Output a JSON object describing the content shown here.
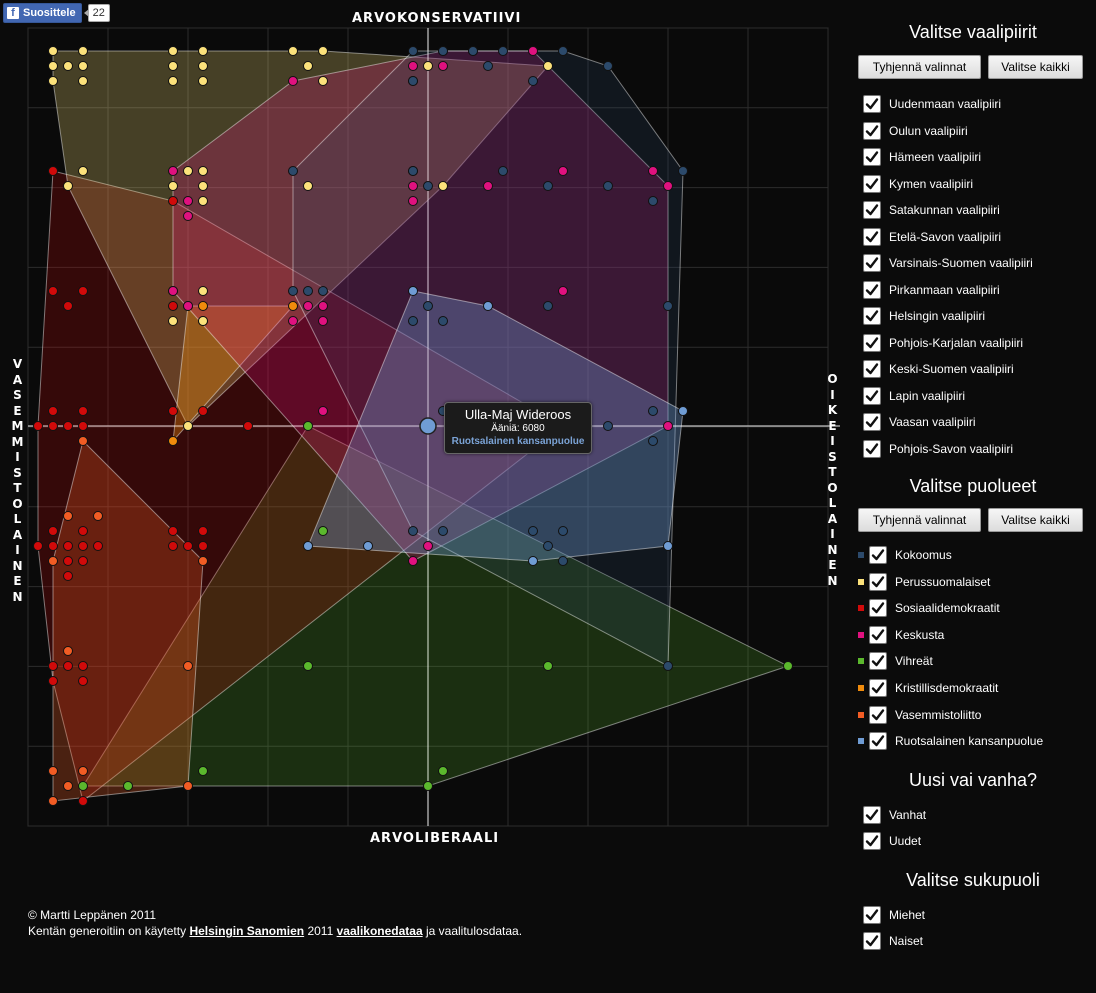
{
  "facebook": {
    "like_label": "Suosittele",
    "like_count": "22"
  },
  "axes": {
    "top": "ARVOKONSERVATIIVI",
    "bottom": "ARVOLIBERAALI",
    "left": "VASEMMISTOLAINEN",
    "right": "OIKEISTOLAINEN"
  },
  "tooltip": {
    "name": "Ulla-Maj Wideroos",
    "votes": "Ääniä: 6080",
    "party": "Ruotsalainen kansanpuolue"
  },
  "footer": {
    "copyright": "© Martti Leppänen 2011",
    "text_prefix": "Kentän generoitiin on käytetty ",
    "link1": "Helsingin Sanomien",
    "text_mid": " 2011 ",
    "link2": "vaalikonedataa",
    "text_suffix": " ja vaalitulosdataa."
  },
  "districts": {
    "title": "Valitse vaalipiirit",
    "clear_label": "Tyhjennä valinnat",
    "all_label": "Valitse kaikki",
    "items": [
      "Uudenmaan vaalipiiri",
      "Oulun vaalipiiri",
      "Hämeen vaalipiiri",
      "Kymen vaalipiiri",
      "Satakunnan vaalipiiri",
      "Etelä-Savon vaalipiiri",
      "Varsinais-Suomen vaalipiiri",
      "Pirkanmaan vaalipiiri",
      "Helsingin vaalipiiri",
      "Pohjois-Karjalan vaalipiiri",
      "Keski-Suomen vaalipiiri",
      "Lapin vaalipiiri",
      "Vaasan vaalipiiri",
      "Pohjois-Savon vaalipiiri"
    ]
  },
  "parties": {
    "title": "Valitse puolueet",
    "clear_label": "Tyhjennä valinnat",
    "all_label": "Valitse kaikki",
    "items": [
      {
        "name": "Kokoomus",
        "color": "#2c4a6b"
      },
      {
        "name": "Perussuomalaiset",
        "color": "#fce27b"
      },
      {
        "name": "Sosiaalidemokraatit",
        "color": "#d10a0a"
      },
      {
        "name": "Keskusta",
        "color": "#e0117f"
      },
      {
        "name": "Vihreät",
        "color": "#5bb82d"
      },
      {
        "name": "Kristillisdemokraatit",
        "color": "#f08b0c"
      },
      {
        "name": "Vasemmistoliitto",
        "color": "#f25c24"
      },
      {
        "name": "Ruotsalainen kansanpuolue",
        "color": "#6f9cd4"
      }
    ]
  },
  "age": {
    "title": "Uusi vai vanha?",
    "items": [
      "Vanhat",
      "Uudet"
    ]
  },
  "gender": {
    "title": "Valitse sukupuoli",
    "items": [
      "Miehet",
      "Naiset"
    ]
  }
}
